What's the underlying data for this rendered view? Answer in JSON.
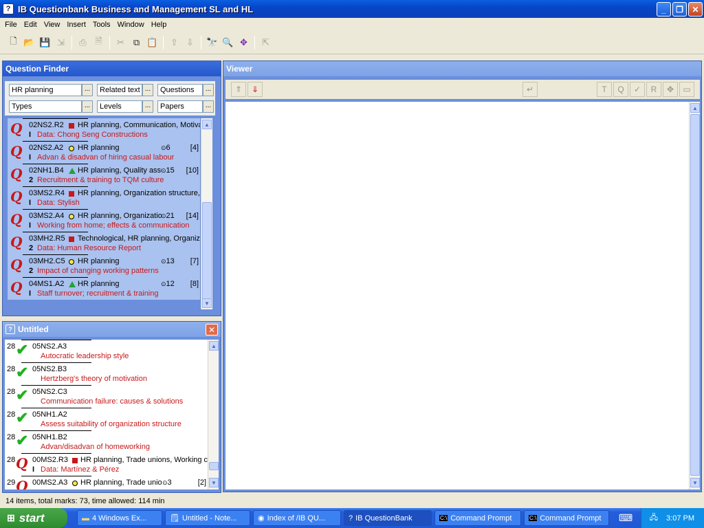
{
  "window": {
    "title": "IB Questionbank Business and Management SL and HL",
    "app_icon": "?"
  },
  "menu": [
    "File",
    "Edit",
    "View",
    "Insert",
    "Tools",
    "Window",
    "Help"
  ],
  "question_finder": {
    "title": "Question Finder",
    "filters": {
      "topic": "HR planning",
      "related": "Related text",
      "questions": "Questions",
      "types": "Types",
      "levels": "Levels",
      "papers": "Papers",
      "browse": "..."
    },
    "items": [
      {
        "code": "02NS2.R2",
        "mark": "square",
        "topic": "HR planning, Communication, Motivation",
        "time": "",
        "marks": "",
        "paper": "I",
        "desc": "Data: Chong Seng Constructions"
      },
      {
        "code": "02NS2.A2",
        "mark": "circle",
        "topic": "HR planning",
        "time": "6",
        "marks": "[4]",
        "paper": "I",
        "desc": "Advan & disadvan of hiring casual labour"
      },
      {
        "code": "02NH1.B4",
        "mark": "triangle",
        "topic": "HR planning, Quality assurance",
        "time": "15",
        "marks": "[10]",
        "paper": "2",
        "desc": "Recruitment & training to TQM culture"
      },
      {
        "code": "03MS2.R4",
        "mark": "square",
        "topic": "HR planning, Organization structure, Communication",
        "time": "",
        "marks": "",
        "paper": "I",
        "desc": "Data: Stylish"
      },
      {
        "code": "03MS2.A4",
        "mark": "circle",
        "topic": "HR planning, Organization structure",
        "time": "21",
        "marks": "[14]",
        "paper": "I",
        "desc": "Working from home; effects & communication"
      },
      {
        "code": "03MH2.R5",
        "mark": "square",
        "topic": "Technological, HR planning, Organization",
        "time": "",
        "marks": "",
        "paper": "2",
        "desc": "Data: Human Resource Report"
      },
      {
        "code": "03MH2.C5",
        "mark": "circle",
        "topic": "HR planning",
        "time": "13",
        "marks": "[7]",
        "paper": "2",
        "desc": "Impact of changing working patterns"
      },
      {
        "code": "04MS1.A2",
        "mark": "triangle",
        "topic": "HR planning",
        "time": "12",
        "marks": "[8]",
        "paper": "I",
        "desc": "Staff turnover; recruitment & training"
      }
    ]
  },
  "untitled": {
    "title": "Untitled",
    "items": [
      {
        "num": "28",
        "icon": "check",
        "code": "05NS2.A3",
        "topic": "",
        "mark": "",
        "time": "",
        "marks": "",
        "paper": "",
        "desc": "Autocratic leadership style"
      },
      {
        "num": "28",
        "icon": "check",
        "code": "05NS2.B3",
        "topic": "",
        "mark": "",
        "time": "",
        "marks": "",
        "paper": "",
        "desc": "Hertzberg's theory of motivation"
      },
      {
        "num": "28",
        "icon": "check",
        "code": "05NS2.C3",
        "topic": "",
        "mark": "",
        "time": "",
        "marks": "",
        "paper": "",
        "desc": "Communication failure: causes & solutions"
      },
      {
        "num": "28",
        "icon": "check",
        "code": "05NH1.A2",
        "topic": "",
        "mark": "",
        "time": "",
        "marks": "",
        "paper": "",
        "desc": "Assess suitability of organization structure"
      },
      {
        "num": "28",
        "icon": "check",
        "code": "05NH1.B2",
        "topic": "",
        "mark": "",
        "time": "",
        "marks": "",
        "paper": "",
        "desc": "Advan/disadvan of homeworking"
      },
      {
        "num": "28",
        "icon": "q",
        "code": "00MS2.R3",
        "topic": "HR planning, Trade unions, Working conditions",
        "mark": "square",
        "time": "",
        "marks": "",
        "paper": "I",
        "desc": "Data: Martínez & Pérez"
      },
      {
        "num": "29",
        "icon": "q",
        "code": "00MS2.A3",
        "topic": "HR planning, Trade unions",
        "mark": "circle",
        "time": "3",
        "marks": "[2]",
        "paper": "",
        "desc": ""
      }
    ]
  },
  "viewer": {
    "title": "Viewer"
  },
  "status": {
    "text": "14 items, total marks: 73, time allowed: 114 min"
  },
  "taskbar": {
    "start": "start",
    "tasks": [
      "4 Windows Ex...",
      "Untitled - Note...",
      "Index of /IB QU...",
      "IB QuestionBank",
      "Command Prompt",
      "Command Prompt"
    ],
    "clock": "3:07 PM"
  },
  "colors": {
    "title_bar": "#0a48d0",
    "finder_bg": "#aac2ef",
    "question_red": "#c8181a",
    "check_green": "#21b01f"
  }
}
